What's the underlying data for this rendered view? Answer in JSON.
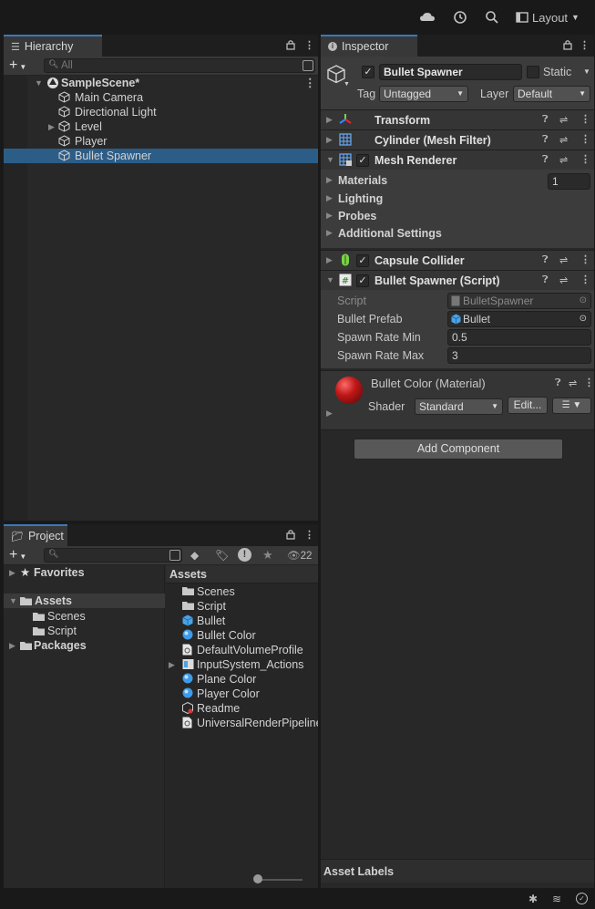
{
  "topbar": {
    "layout_label": "Layout"
  },
  "hierarchy": {
    "tab_label": "Hierarchy",
    "search_placeholder": "All",
    "scene": "SampleScene*",
    "items": [
      {
        "label": "Main Camera",
        "has_children": false,
        "selected": false
      },
      {
        "label": "Directional Light",
        "has_children": false,
        "selected": false
      },
      {
        "label": "Level",
        "has_children": true,
        "selected": false
      },
      {
        "label": "Player",
        "has_children": false,
        "selected": false
      },
      {
        "label": "Bullet Spawner",
        "has_children": false,
        "selected": true
      }
    ]
  },
  "inspector": {
    "tab_label": "Inspector",
    "object_name": "Bullet Spawner",
    "static_label": "Static",
    "tag_label": "Tag",
    "tag_value": "Untagged",
    "layer_label": "Layer",
    "layer_value": "Default",
    "components": {
      "transform": "Transform",
      "mesh_filter": "Cylinder (Mesh Filter)",
      "mesh_renderer": "Mesh Renderer",
      "capsule_collider": "Capsule Collider",
      "script": "Bullet Spawner (Script)"
    },
    "mesh_renderer_sections": {
      "materials": "Materials",
      "materials_count": "1",
      "lighting": "Lighting",
      "probes": "Probes",
      "additional": "Additional Settings"
    },
    "script_fields": {
      "script_label": "Script",
      "script_value": "BulletSpawner",
      "prefab_label": "Bullet Prefab",
      "prefab_value": "Bullet",
      "rate_min_label": "Spawn Rate Min",
      "rate_min_value": "0.5",
      "rate_max_label": "Spawn Rate Max",
      "rate_max_value": "3"
    },
    "material": {
      "name": "Bullet Color (Material)",
      "shader_label": "Shader",
      "shader_value": "Standard",
      "edit_label": "Edit..."
    },
    "add_component": "Add Component",
    "asset_labels": "Asset Labels"
  },
  "project": {
    "tab_label": "Project",
    "hidden_count": "22",
    "tree": {
      "favorites": "Favorites",
      "assets": "Assets",
      "scenes": "Scenes",
      "script": "Script",
      "packages": "Packages"
    },
    "assets_header": "Assets",
    "assets": [
      {
        "label": "Scenes",
        "icon": "folder-icon"
      },
      {
        "label": "Script",
        "icon": "folder-icon"
      },
      {
        "label": "Bullet",
        "icon": "prefab-icon"
      },
      {
        "label": "Bullet Color",
        "icon": "material-icon"
      },
      {
        "label": "DefaultVolumeProfile",
        "icon": "asset-icon"
      },
      {
        "label": "InputSystem_Actions",
        "icon": "input-actions-icon"
      },
      {
        "label": "Plane Color",
        "icon": "material-icon"
      },
      {
        "label": "Player Color",
        "icon": "material-icon"
      },
      {
        "label": "Readme",
        "icon": "readme-icon"
      },
      {
        "label": "UniversalRenderPipelineGlobalSettings",
        "icon": "asset-icon"
      }
    ]
  },
  "colors": {
    "selection": "#2c5d87",
    "tab_accent": "#3a79bb",
    "material_sphere": "#c01818"
  }
}
